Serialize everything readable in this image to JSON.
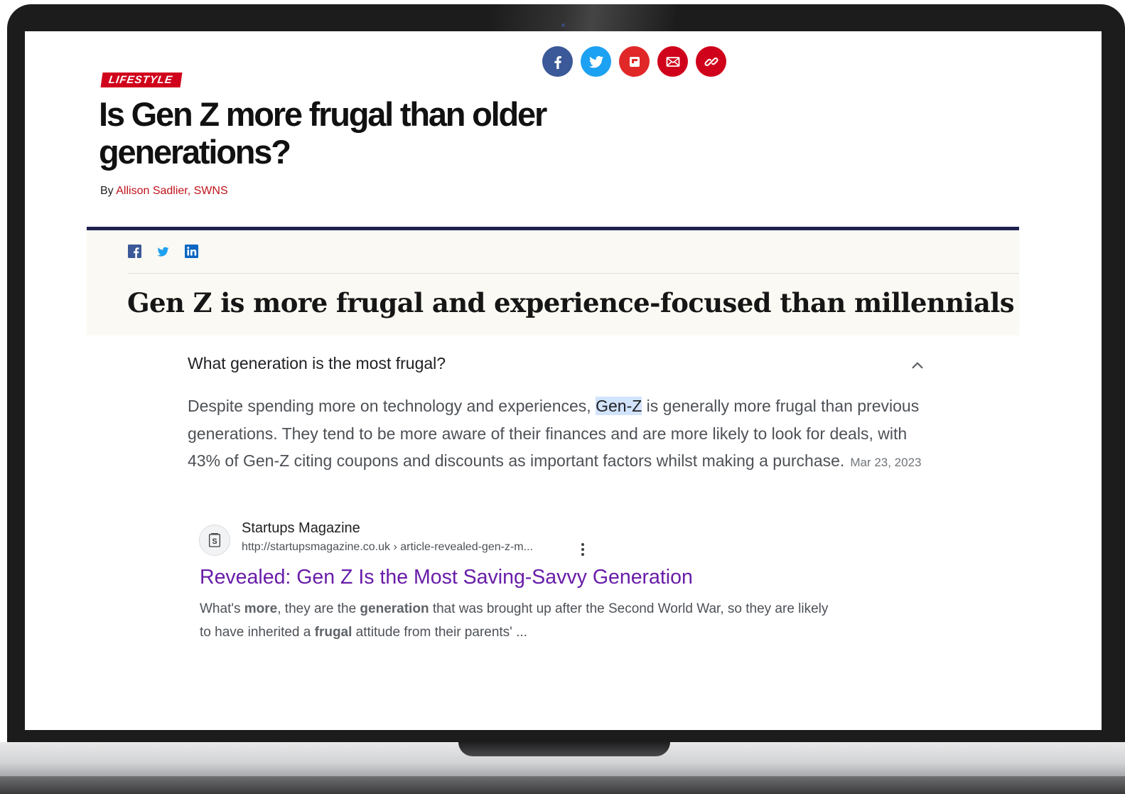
{
  "article": {
    "category": "LIFESTYLE",
    "headline": "Is Gen Z more frugal than older generations?",
    "byline_prefix": "By",
    "author": "Allison Sadlier, SWNS",
    "share_icons": [
      "facebook-icon",
      "twitter-icon",
      "flipboard-icon",
      "email-icon",
      "link-icon"
    ]
  },
  "embed": {
    "social_icons": [
      "facebook-icon",
      "twitter-icon",
      "linkedin-icon"
    ],
    "title": "Gen Z is more frugal and experience-focused than millennials"
  },
  "search_snippet": {
    "question": "What generation is the most frugal?",
    "answer_before": "Despite spending more on technology and experiences, ",
    "answer_highlight": "Gen-Z",
    "answer_after": " is generally more frugal than previous generations. They tend to be more aware of their finances and are more likely to look for deals, with 43% of Gen-Z citing coupons and discounts as important factors whilst making a purchase.",
    "date": "Mar 23, 2023",
    "source_name": "Startups Magazine",
    "source_url": "http://startupsmagazine.co.uk › article-revealed-gen-z-m...",
    "favicon_letter": "S",
    "result_title": "Revealed: Gen Z Is the Most Saving-Savvy Generation",
    "snippet_parts": [
      {
        "text": "What's ",
        "bold": false
      },
      {
        "text": "more",
        "bold": true
      },
      {
        "text": ", they are the ",
        "bold": false
      },
      {
        "text": "generation",
        "bold": true
      },
      {
        "text": " that was brought up after the Second World War, so they are likely to have inherited a ",
        "bold": false
      },
      {
        "text": "frugal",
        "bold": true
      },
      {
        "text": " attitude from their parents' ...",
        "bold": false
      }
    ]
  },
  "colors": {
    "brand_red": "#d0021b",
    "facebook_blue": "#3b5998",
    "twitter_blue": "#1da1f2",
    "embed_border": "#1f2250",
    "link_visited": "#681da8"
  }
}
